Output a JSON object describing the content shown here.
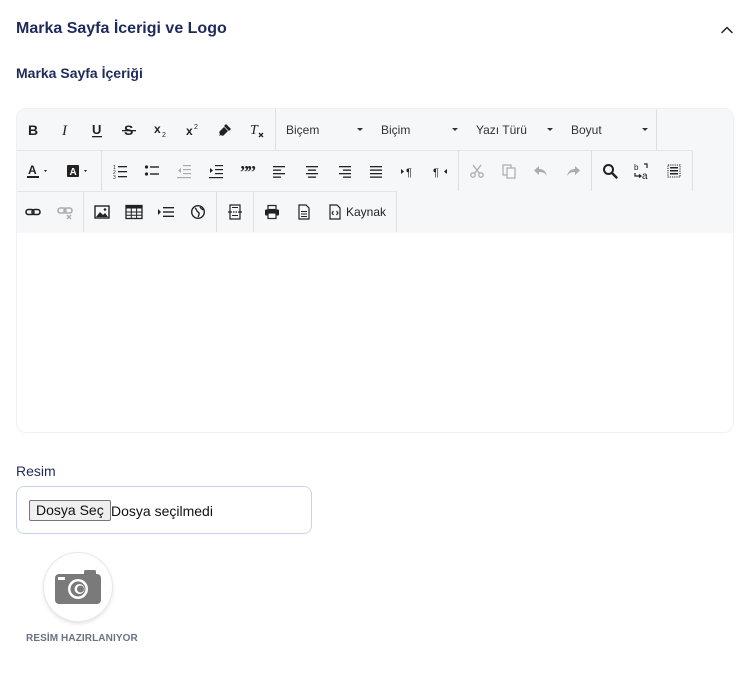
{
  "section": {
    "title": "Marka Sayfa İcerigi ve Logo"
  },
  "content_field": {
    "label": "Marka Sayfa İçeriği"
  },
  "toolbar": {
    "dropdowns": [
      "Biçem",
      "Biçim",
      "Yazı Türü",
      "Boyut"
    ],
    "source_label": "Kaynak"
  },
  "image_field": {
    "label": "Resim",
    "file_button": "Dosya Seç",
    "file_status": "Dosya seçilmedi",
    "preview_caption": "RESİM HAZIRLANIYOR"
  },
  "colors": {
    "accent": "#1f2a5c",
    "toolbar_bg": "#f6f7f9",
    "input_border": "#c9d4ea"
  }
}
